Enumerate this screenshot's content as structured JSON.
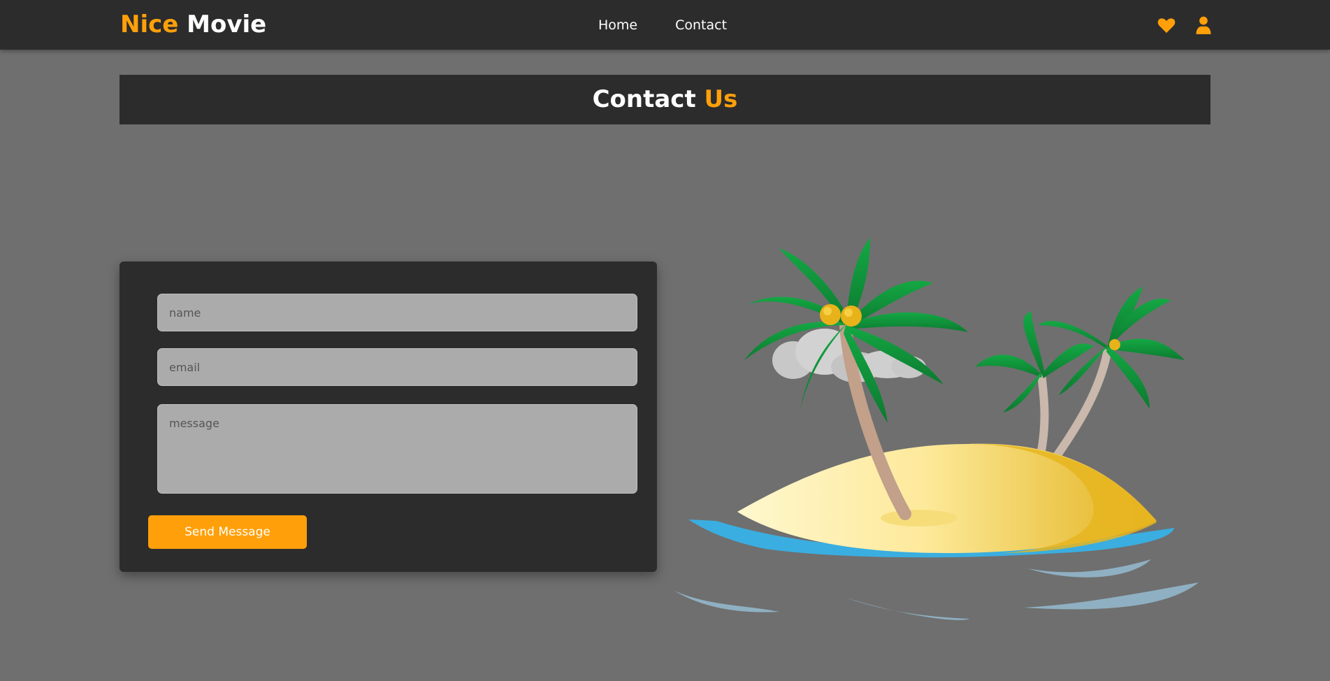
{
  "navbar": {
    "logo_accent": "Nice",
    "logo_rest": "Movie",
    "links": [
      {
        "label": "Home"
      },
      {
        "label": "Contact"
      }
    ],
    "icons": [
      "heart-icon",
      "user-icon"
    ]
  },
  "page_title": {
    "white": "Contact",
    "orange": "Us"
  },
  "form": {
    "name_placeholder": "name",
    "email_placeholder": "email",
    "message_placeholder": "message",
    "submit_label": "Send Message"
  },
  "colors": {
    "accent": "#ffa00a",
    "dark_panel": "#2c2c2c",
    "background": "#6f6f6f",
    "input_bg": "#ababab"
  }
}
